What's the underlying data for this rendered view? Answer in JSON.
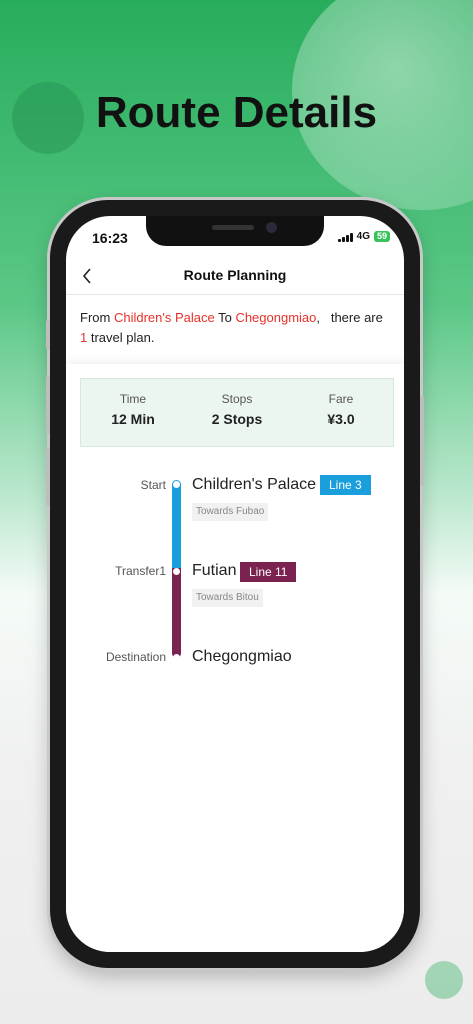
{
  "hero": {
    "title": "Route Details"
  },
  "status_bar": {
    "time": "16:23",
    "network": "4G",
    "battery": "59"
  },
  "navbar": {
    "title": "Route Planning",
    "back_icon": "chevron-left-icon"
  },
  "summary": {
    "from_word": "From ",
    "origin": "Children's Palace",
    "to_word": " To ",
    "destination": "Chegongmiao",
    "mid_text": ",   there are ",
    "plan_count": "1",
    "end_text": " travel plan."
  },
  "stats": {
    "time_label": "Time",
    "time_value": "12 Min",
    "stops_label": "Stops",
    "stops_value": "2 Stops",
    "fare_label": "Fare",
    "fare_value": "¥3.0"
  },
  "route": {
    "start_label": "Start",
    "start_station": "Children's Palace",
    "start_line": "Line 3",
    "start_towards": "Towards Fubao",
    "transfer_label": "Transfer1",
    "transfer_station": "Futian",
    "transfer_line": "Line 11",
    "transfer_towards": "Towards Bitou",
    "dest_label": "Destination",
    "dest_station": "Chegongmiao"
  },
  "colors": {
    "line3": "#1a9fdc",
    "line11": "#7b2350",
    "highlight": "#e8302a",
    "brand_green": "#27ad5c"
  }
}
